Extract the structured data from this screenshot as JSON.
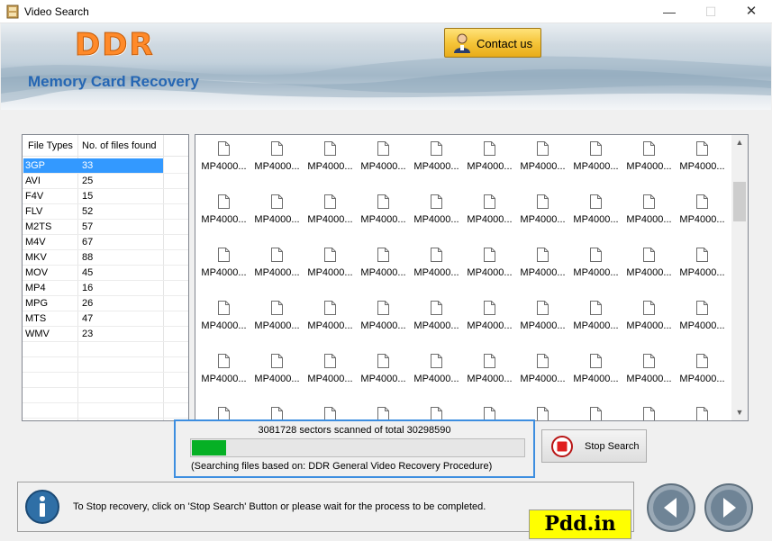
{
  "window": {
    "title": "Video Search",
    "minimize": "—",
    "maximize": "☐",
    "close": "✕"
  },
  "banner": {
    "logo": "DDR",
    "subtitle": "Memory Card Recovery",
    "contact_label": "Contact us"
  },
  "file_types": {
    "headers": [
      "File Types",
      "No. of files found"
    ],
    "rows": [
      {
        "type": "3GP",
        "count": "33",
        "selected": true
      },
      {
        "type": "AVI",
        "count": "25"
      },
      {
        "type": "F4V",
        "count": "15"
      },
      {
        "type": "FLV",
        "count": "52"
      },
      {
        "type": "M2TS",
        "count": "57"
      },
      {
        "type": "M4V",
        "count": "67"
      },
      {
        "type": "MKV",
        "count": "88"
      },
      {
        "type": "MOV",
        "count": "45"
      },
      {
        "type": "MP4",
        "count": "16"
      },
      {
        "type": "MPG",
        "count": "26"
      },
      {
        "type": "MTS",
        "count": "47"
      },
      {
        "type": "WMV",
        "count": "23"
      }
    ]
  },
  "files": {
    "item_label": "MP4000...",
    "rows_visible": 6,
    "cols_visible": 10
  },
  "progress": {
    "text": "3081728 sectors scanned of total 30298590",
    "fraction": 0.102,
    "note": "(Searching files based on:  DDR General Video Recovery Procedure)"
  },
  "stop_button": {
    "label": "Stop Search"
  },
  "status": {
    "text": "To Stop recovery, click on 'Stop Search' Button or please wait for the process to be completed."
  },
  "watermark": "Pdd.in",
  "colors": {
    "accent": "#3399ff",
    "progress": "#06b025",
    "logo": "#ff8a2a",
    "subtitle": "#2566b3"
  }
}
